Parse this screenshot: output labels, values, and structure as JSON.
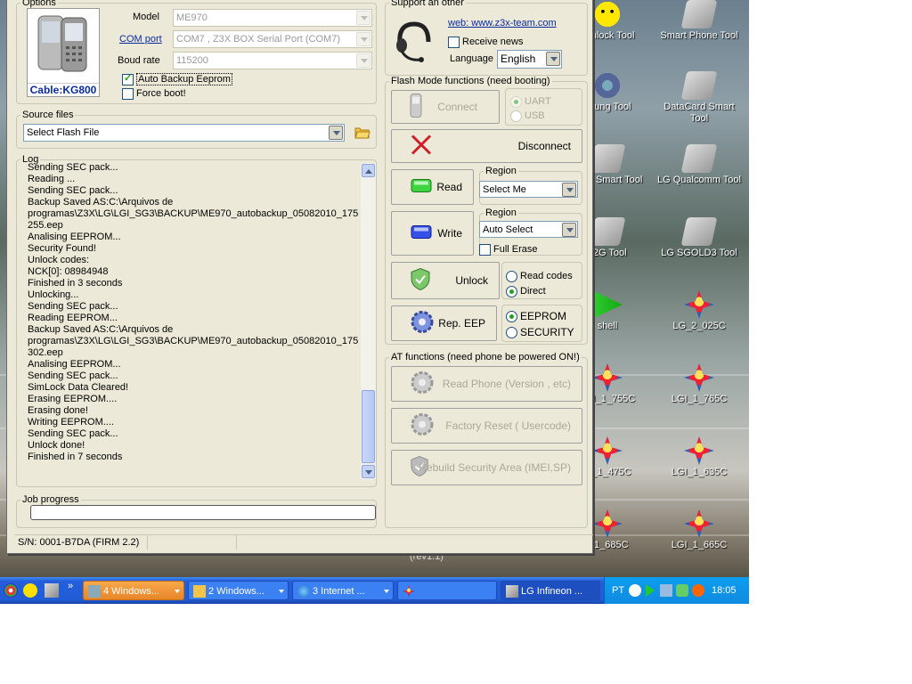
{
  "window": {
    "options_legend": "Options",
    "cable_label": "Cable:KG800",
    "model_label": "Model",
    "model_value": "ME970",
    "com_label": "COM port",
    "com_value": "COM7 , Z3X BOX Serial Port (COM7)",
    "baud_label": "Boud rate",
    "baud_value": "115200",
    "auto_backup": "Auto Backup Eeprom",
    "auto_backup_checked": true,
    "force_boot": "Force boot!",
    "force_boot_checked": false,
    "source_legend": "Source files",
    "flash_file": "Select Flash File",
    "log_legend": "Log",
    "log_lines": [
      "Sending SEC pack...",
      "Reading ...",
      "Sending SEC pack...",
      "Backup Saved AS:C:\\Arquivos de",
      "programas\\Z3X\\LG\\LGI_SG3\\BACKUP\\ME970_autobackup_05082010_175",
      "255.eep",
      "Analising EEPROM...",
      "Security Found!",
      "Unlock codes:",
      "NCK[0]: 08984948",
      "Finished in 3 seconds",
      "Unlocking...",
      "Sending SEC pack...",
      "Reading EEPROM...",
      "Backup Saved AS:C:\\Arquivos de",
      "programas\\Z3X\\LG\\LGI_SG3\\BACKUP\\ME970_autobackup_05082010_175",
      "302.eep",
      "Analising EEPROM...",
      "Sending SEC pack...",
      "SimLock Data Cleared!",
      "Erasing EEPROM....",
      "Erasing done!",
      "Writing EEPROM....",
      "Sending SEC pack...",
      "Unlock done!",
      "Finished in 7 seconds"
    ],
    "job_legend": "Job progress",
    "job_progress": 0,
    "status_serial": "S/N: 0001-B7DA (FIRM 2.2)",
    "support_legend": "Support an other",
    "web_link": "web: www.z3x-team.com",
    "receive_news": "Receive news",
    "language_label": "Language",
    "language_value": "English",
    "flash_legend": "Flash Mode functions (need booting)",
    "connect": "Connect",
    "uart": "UART",
    "usb": "USB",
    "disconnect": "Disconnect",
    "read": "Read",
    "write": "Write",
    "region_label": "Region",
    "region_read": "Select Me",
    "region_write": "Auto Select",
    "full_erase": "Full Erase",
    "unlock": "Unlock",
    "read_codes": "Read codes",
    "direct": "Direct",
    "rep_eep": "Rep. EEP",
    "eeprom": "EEPROM",
    "security": "SECURITY",
    "at_legend": "AT functions (need phone be powered ON!)",
    "read_phone": "Read Phone (Version , etc)",
    "factory_reset": "Factory Reset ( Usercode)",
    "rebuild": "Rebuild Security Area (IMEI,SP)"
  },
  "desktop": [
    {
      "label": "I unlock Tool",
      "icon": "smiley-icon"
    },
    {
      "label": "Smart Phone Tool",
      "icon": "phone-icon"
    },
    {
      "label": "nsung Tool",
      "icon": "gear-icon"
    },
    {
      "label": "DataCard Smart Tool",
      "icon": "disk-icon"
    },
    {
      "label": "aTek Smart Tool",
      "icon": "mtk-icon"
    },
    {
      "label": "LG Qualcomm Tool",
      "icon": "disk-icon"
    },
    {
      "label": "i 2G Tool",
      "icon": "disk-icon"
    },
    {
      "label": "LG SGOLD3 Tool",
      "icon": "disk-icon"
    },
    {
      "label": "shell",
      "icon": "arrow-icon"
    },
    {
      "label": "LG_2_025C",
      "icon": "star-icon"
    },
    {
      "label": "LGI_1_755C",
      "icon": "star-icon"
    },
    {
      "label": "LGI_1_765C",
      "icon": "star-icon"
    },
    {
      "label": "Q_1_475C",
      "icon": "star-icon"
    },
    {
      "label": "LGI_1_635C",
      "icon": "star-icon"
    },
    {
      "label": "i_1_685C",
      "icon": "star-icon"
    },
    {
      "label": "LGI_1_665C",
      "icon": "star-icon"
    }
  ],
  "desktop_caption": "(rev1.1)",
  "taskbar": {
    "t1": "4 Windows...",
    "t2": "2 Windows...",
    "t3": "3 Internet ...",
    "t5": "LG Infineon ...",
    "lang": "PT",
    "clock": "18:05"
  }
}
